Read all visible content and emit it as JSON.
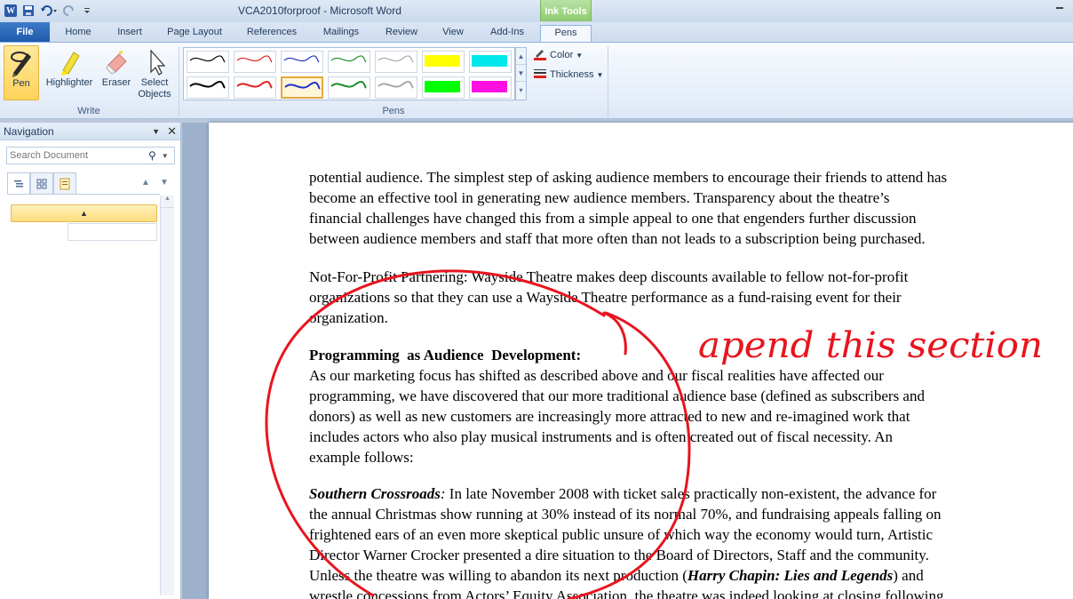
{
  "window": {
    "doc_name": "VCA2010forproof",
    "app_name": "Microsoft Word",
    "title_separator": " - ",
    "contextual_tab_group": "Ink Tools"
  },
  "tabs": [
    {
      "label": "File"
    },
    {
      "label": "Home"
    },
    {
      "label": "Insert"
    },
    {
      "label": "Page Layout"
    },
    {
      "label": "References"
    },
    {
      "label": "Mailings"
    },
    {
      "label": "Review"
    },
    {
      "label": "View"
    },
    {
      "label": "Add-Ins"
    },
    {
      "label": "Pens"
    }
  ],
  "ribbon": {
    "write_group": {
      "label": "Write",
      "buttons": [
        {
          "label": "Pen",
          "icon": "pen-icon"
        },
        {
          "label": "Highlighter",
          "icon": "highlighter-icon"
        },
        {
          "label": "Eraser",
          "icon": "eraser-icon"
        },
        {
          "label": "Select",
          "label2": "Objects",
          "icon": "select-arrow-icon"
        }
      ]
    },
    "pens_group": {
      "label": "Pens",
      "swatches_row1": [
        "#000000",
        "#e02020",
        "#2030c8",
        "#1e8c28",
        "#a8a8a8",
        "#ffff00",
        "#00e8ec"
      ],
      "swatches_row2": [
        "#000000",
        "#e02020",
        "#2030c8",
        "#1e8c28",
        "#a8a8a8",
        "#00ff00",
        "#ff10e0"
      ],
      "selected_swatch": "row2-2",
      "color_label": "Color",
      "thickness_label": "Thickness"
    }
  },
  "navigation": {
    "title": "Navigation",
    "search_placeholder": "Search Document"
  },
  "document": {
    "para1": [
      "potential audience. The simplest step of asking audience members to encourage their friends to attend has",
      "become an effective tool in generating new audience members. Transparency about the theatre’s",
      "financial challenges have changed this from a simple appeal to one that engenders further discussion",
      "between audience members and staff that more often than not leads to a subscription being purchased."
    ],
    "para2": [
      "Not-For-Profit Partnering: Wayside Theatre makes deep discounts available to fellow not-for-profit",
      "organizations so that they can use a Wayside Theatre performance as a fund-raising event for their",
      "organization."
    ],
    "heading": "Programming  as Audience  Development:",
    "para3": [
      "As our marketing focus has shifted as described above and our fiscal realities have affected our",
      "programming, we have discovered that our more traditional audience base (defined as subscribers and",
      "donors) as well as new customers are increasingly more attracted to new and re-imagined work that",
      "includes actors who also play musical instruments and is often created out of fiscal necessity. An",
      "example follows:"
    ],
    "para4": {
      "title": "Southern Crossroads",
      "colon": ":",
      "first_line_rest": " In late November 2008 with ticket sales practically non-existent, the advance for",
      "lines": [
        "the annual Christmas show running at 30% instead of its normal 70%, and fundraising appeals falling on",
        "frightened ears of an even more skeptical public unsure of which way the economy would turn, Artistic",
        "Director Warner Crocker presented a dire situation to the Board of Directors, Staff and the community."
      ],
      "line5_start": "Unless the theatre was willing to abandon its next production (",
      "line5_title": "Harry Chapin: Lies and Legends",
      "line5_end": ") and",
      "line6": "wrestle concessions from Actors’ Equity Association, the theatre was indeed looking at closing following"
    },
    "ink_annotation": "apend this section",
    "ink_color": "#e8141e"
  }
}
